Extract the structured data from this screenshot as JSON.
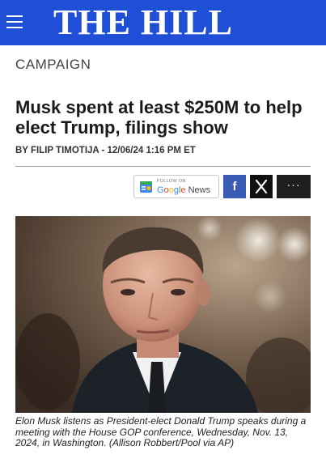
{
  "header": {
    "brand": "THE HILL",
    "menu_icon": "hamburger-menu-icon",
    "background": "#1f4fd6"
  },
  "article": {
    "section": "CAMPAIGN",
    "headline": "Musk spent at least $250M to help elect Trump, filings show",
    "byline": "BY FILIP TIMOTIJA - 12/06/24 1:16 PM ET"
  },
  "share": {
    "google_news_small": "FOLLOW ON",
    "google_news_label": "Google News",
    "facebook_icon": "facebook-icon",
    "x_icon": "x-icon",
    "more_label": "···"
  },
  "media": {
    "caption": "Elon Musk listens as President-elect Donald Trump speaks during a meeting with the House GOP conference, Wednesday, Nov. 13, 2024, in Washington. (Allison Robbert/Pool via AP)"
  }
}
